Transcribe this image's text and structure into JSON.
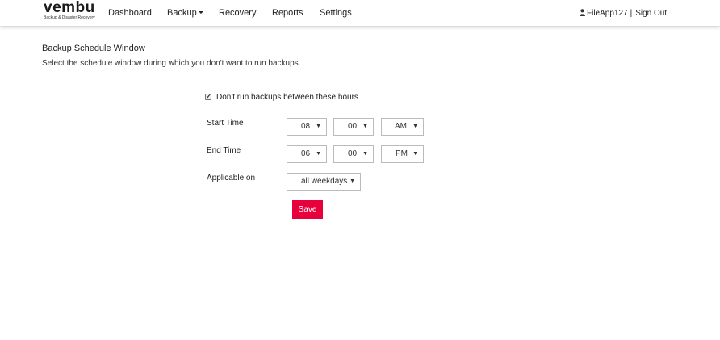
{
  "header": {
    "logo_text": "vembu",
    "logo_tagline": "Backup & Disaster Recovery",
    "nav": {
      "dashboard": "Dashboard",
      "backup": "Backup",
      "recovery": "Recovery",
      "reports": "Reports",
      "settings": "Settings"
    },
    "user_icon": "user-icon",
    "username": "FileApp127",
    "separator": "|",
    "sign_out": "Sign Out"
  },
  "page": {
    "title": "Backup Schedule Window",
    "description": "Select the schedule window during which you don't want to run backups."
  },
  "form": {
    "checkbox_checked": true,
    "checkbox_label": "Don't run backups between these hours",
    "start_time": {
      "label": "Start Time",
      "hour": "08",
      "minute": "00",
      "meridiem": "AM"
    },
    "end_time": {
      "label": "End Time",
      "hour": "06",
      "minute": "00",
      "meridiem": "PM"
    },
    "applicable_on": {
      "label": "Applicable on",
      "value": "all weekdays"
    },
    "dropdown_arrow": "▼",
    "check_glyph": "✔",
    "save_label": "Save"
  },
  "colors": {
    "accent": "#e8003d",
    "text": "#222222"
  }
}
